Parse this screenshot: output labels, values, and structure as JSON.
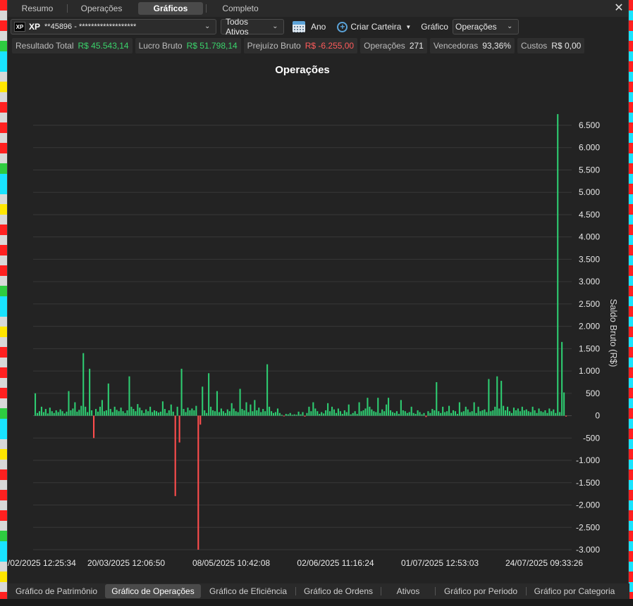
{
  "tabs": [
    "Resumo",
    "Operações",
    "Gráficos",
    "Completo"
  ],
  "active_tab": "Gráficos",
  "toolbar": {
    "broker": "XP",
    "account": "**45896 - *******************",
    "assets": "Todos Ativos",
    "period": "Ano",
    "create_portfolio": "Criar Carteira",
    "chart_label": "Gráfico",
    "chart_select": "Operações"
  },
  "stats": [
    {
      "label": "Resultado Total",
      "value": "R$ 45.543,14",
      "tone": "pos"
    },
    {
      "label": "Lucro Bruto",
      "value": "R$ 51.798,14",
      "tone": "pos"
    },
    {
      "label": "Prejuízo Bruto",
      "value": "R$ -6.255,00",
      "tone": "neg"
    },
    {
      "label": "Operações",
      "value": "271",
      "tone": ""
    },
    {
      "label": "Vencedoras",
      "value": "93,36%",
      "tone": ""
    },
    {
      "label": "Custos",
      "value": "R$ 0,00",
      "tone": ""
    }
  ],
  "chart_data": {
    "type": "bar",
    "title": "Operações",
    "ylabel": "Saldo Bruto (R$)",
    "ylim": [
      -3000,
      6500
    ],
    "y_ticks": [
      6500,
      6000,
      5500,
      5000,
      4500,
      4000,
      3500,
      3000,
      2500,
      2000,
      1500,
      1000,
      500,
      0,
      -500,
      -1000,
      -1500,
      -2000,
      -2500,
      -3000
    ],
    "y_tick_labels": [
      "6.500",
      "6.000",
      "5.500",
      "5.000",
      "4.500",
      "4.000",
      "3.500",
      "3.000",
      "2.500",
      "2.000",
      "1.500",
      "1.000",
      "500",
      "0",
      "-500",
      "-1.000",
      "-1.500",
      "-2.000",
      "-2.500",
      "-3.000"
    ],
    "x_tick_labels": [
      "/02/2025 12:25:34",
      "20/03/2025 12:06:50",
      "08/05/2025 10:42:08",
      "02/06/2025 11:16:24",
      "01/07/2025 12:53:03",
      "24/07/2025 09:33:26"
    ],
    "positive_color": "#2ecc71",
    "negative_color": "#ff4d4d",
    "grid": true,
    "values": [
      500,
      60,
      100,
      200,
      80,
      150,
      50,
      180,
      100,
      60,
      120,
      80,
      140,
      100,
      50,
      90,
      550,
      120,
      160,
      300,
      90,
      130,
      220,
      1400,
      200,
      80,
      1050,
      120,
      -500,
      150,
      90,
      200,
      350,
      100,
      120,
      720,
      150,
      80,
      200,
      130,
      100,
      180,
      100,
      60,
      120,
      880,
      200,
      150,
      100,
      260,
      180,
      120,
      60,
      140,
      100,
      200,
      80,
      120,
      100,
      70,
      90,
      320,
      150,
      60,
      120,
      250,
      90,
      -1800,
      200,
      -600,
      1050,
      150,
      80,
      180,
      120,
      160,
      120,
      220,
      -3000,
      -200,
      650,
      120,
      60,
      950,
      200,
      120,
      100,
      550,
      80,
      160,
      100,
      60,
      140,
      100,
      280,
      160,
      100,
      80,
      600,
      150,
      120,
      300,
      80,
      250,
      100,
      350,
      120,
      180,
      80,
      150,
      100,
      1150,
      200,
      100,
      60,
      80,
      160,
      60,
      20,
      -10,
      40,
      30,
      60,
      20,
      30,
      20,
      90,
      30,
      80,
      -20,
      60,
      200,
      100,
      300,
      160,
      100,
      40,
      80,
      50,
      120,
      280,
      100,
      200,
      140,
      60,
      160,
      100,
      40,
      120,
      80,
      250,
      30,
      60,
      100,
      40,
      300,
      100,
      120,
      160,
      400,
      200,
      140,
      100,
      80,
      400,
      60,
      140,
      100,
      250,
      400,
      120,
      80,
      60,
      100,
      40,
      350,
      120,
      100,
      60,
      80,
      200,
      60,
      40,
      120,
      80,
      30,
      60,
      -30,
      100,
      60,
      150,
      120,
      750,
      100,
      60,
      200,
      80,
      100,
      220,
      60,
      120,
      100,
      40,
      300,
      80,
      100,
      200,
      140,
      80,
      100,
      300,
      60,
      200,
      100,
      120,
      140,
      80,
      820,
      100,
      120,
      200,
      880,
      160,
      780,
      220,
      120,
      200,
      100,
      60,
      180,
      120,
      160,
      100,
      200,
      120,
      140,
      100,
      80,
      200,
      120,
      60,
      160,
      100,
      80,
      120,
      60,
      160,
      100,
      140,
      60,
      6750,
      80,
      1650,
      520,
      -20
    ]
  },
  "bottom_tabs": [
    "Gráfico de Patrimônio",
    "Gráfico de Operações",
    "Gráfico de Eficiência",
    "Gráfico de Ordens",
    "Ativos",
    "Gráfico por Periodo",
    "Gráfico por Categoria"
  ],
  "active_bottom_tab": "Gráfico de Operações",
  "colors": {
    "accent": "#5ba3d9",
    "positive": "#3ad36b",
    "negative": "#ff5b5b"
  }
}
